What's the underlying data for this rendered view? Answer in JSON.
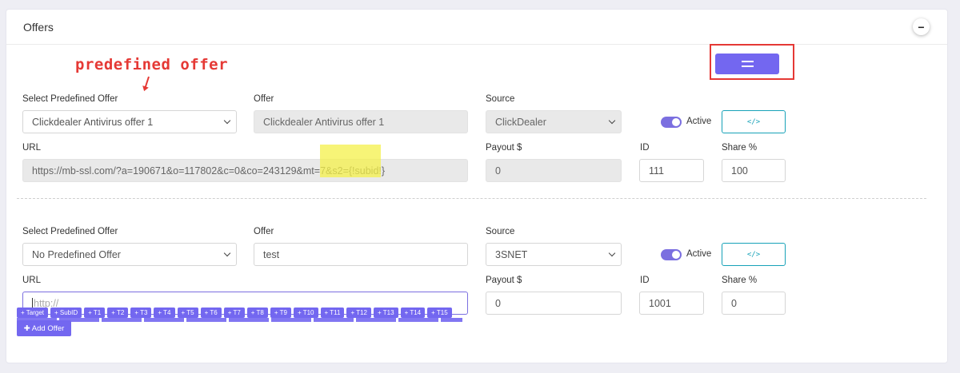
{
  "card": {
    "title": "Offers",
    "collapse_symbol": "−"
  },
  "annotation": {
    "text": "predefined offer"
  },
  "offers": [
    {
      "predefined_label": "Select Predefined Offer",
      "predefined_value": "Clickdealer Antivirus offer 1",
      "offer_label": "Offer",
      "offer_value": "Clickdealer Antivirus offer 1",
      "source_label": "Source",
      "source_value": "ClickDealer",
      "active_label": "Active",
      "url_label": "URL",
      "url_value": "https://mb-ssl.com/?a=190671&o=117802&c=0&co=243129&mt=7&s2={!subid!}",
      "payout_label": "Payout $",
      "payout_value": "0",
      "id_label": "ID",
      "id_value": "111",
      "share_label": "Share %",
      "share_value": "100"
    },
    {
      "predefined_label": "Select Predefined Offer",
      "predefined_value": "No Predefined Offer",
      "offer_label": "Offer",
      "offer_value": "test",
      "source_label": "Source",
      "source_value": "3SNET",
      "active_label": "Active",
      "url_label": "URL",
      "url_placeholder": "http://",
      "payout_label": "Payout $",
      "payout_value": "0",
      "id_label": "ID",
      "id_value": "1001",
      "share_label": "Share %",
      "share_value": "0"
    }
  ],
  "code_button_symbol": "</>",
  "token_tags": [
    "+ Target",
    "+ SubID",
    "+ T1",
    "+ T2",
    "+ T3",
    "+ T4",
    "+ T5",
    "+ T6",
    "+ T7",
    "+ T8",
    "+ T9",
    "+ T10",
    "+ T11",
    "+ T12",
    "+ T13",
    "+ T14",
    "+ T15"
  ],
  "add_offer_label": "✚ Add Offer",
  "colors": {
    "accent": "#7367f0",
    "info": "#17a2b8",
    "annotation_red": "#e53935",
    "highlight": "#f4f04a"
  }
}
